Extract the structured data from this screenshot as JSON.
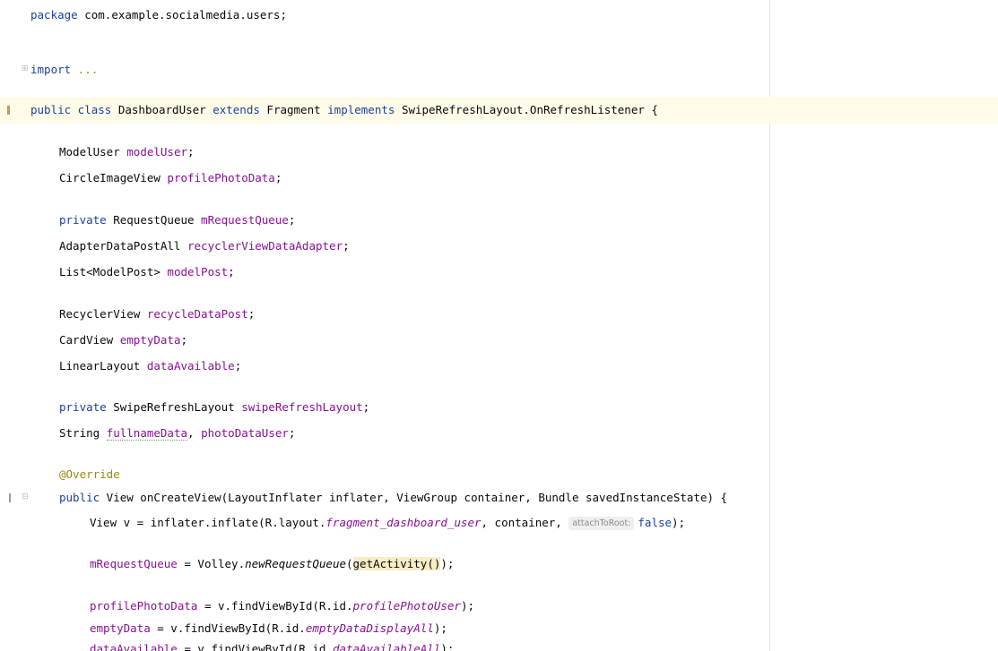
{
  "editor": {
    "package_line": {
      "kw": "package",
      "rest": " com.example.socialmedia.users;"
    },
    "import_line": {
      "kw": "import",
      "collapsed": " ..."
    },
    "class_decl": {
      "kw1": "public class",
      "name": " DashboardUser ",
      "kw2": "extends",
      "mid": " Fragment ",
      "kw3": "implements",
      "tail": " SwipeRefreshLayout.OnRefreshListener {"
    },
    "fields": {
      "model_user": {
        "type": "ModelUser ",
        "name": "modelUser",
        "end": ";"
      },
      "profile_photo": {
        "type": "CircleImageView ",
        "name": "profilePhotoData",
        "end": ";"
      },
      "request_queue": {
        "kw": "private",
        "type": " RequestQueue ",
        "name": "mRequestQueue",
        "end": ";"
      },
      "adapter": {
        "type": "AdapterDataPostAll ",
        "name": "recyclerViewDataAdapter",
        "end": ";"
      },
      "model_post": {
        "type": "List<ModelPost> ",
        "name": "modelPost",
        "end": ";"
      },
      "recycle_view": {
        "type": "RecyclerView ",
        "name": "recycleDataPost",
        "end": ";"
      },
      "empty_data": {
        "type": "CardView ",
        "name": "emptyData",
        "end": ";"
      },
      "data_available": {
        "type": "LinearLayout ",
        "name": "dataAvailable",
        "end": ";"
      },
      "swipe_refresh": {
        "kw": "private",
        "type": " SwipeRefreshLayout ",
        "name": "swipeRefreshLayout",
        "end": ";"
      },
      "strings": {
        "type": "String ",
        "name1": "fullnameData",
        "sep": ", ",
        "name2": "photoDataUser",
        "end": ";"
      }
    },
    "annotation": "@Override",
    "method_decl": {
      "kw": "public",
      "rest": " View onCreateView(LayoutInflater inflater, ViewGroup container, Bundle savedInstanceState) {"
    },
    "inflate_line": {
      "pre": "View v = inflater.inflate(R.layout.",
      "layout_id": "fragment_dashboard_user",
      "mid": ", container, ",
      "hint": "attachToRoot:",
      "kw": "false",
      "end": ");"
    },
    "queue_line": {
      "field": "mRequestQueue",
      "pre": " = Volley.",
      "method": "newRequestQueue",
      "open": "(",
      "arg": "getActivity()",
      "end": ");"
    },
    "find_photo": {
      "field": "profilePhotoData",
      "pre": " = v.findViewById(R.id.",
      "id": "profilePhotoUser",
      "end": ");"
    },
    "find_empty": {
      "field": "emptyData",
      "pre": " = v.findViewById(R.id.",
      "id": "emptyDataDisplayAll",
      "end": ");"
    },
    "find_available": {
      "field": "dataAvailable",
      "pre": " = v.findViewById(R.id.",
      "id": "dataAvailableAll",
      "end": ");"
    }
  },
  "icons": {
    "fold": "fold-collapsed-icon",
    "change_marker": "vcs-change-marker-icon",
    "override_marker": "override-method-icon"
  },
  "colors": {
    "keyword": "#1b3fa0",
    "field": "#871094",
    "annotation": "#9e880d",
    "highlight_line": "#fefbe9",
    "marker": "#e88b3a"
  }
}
